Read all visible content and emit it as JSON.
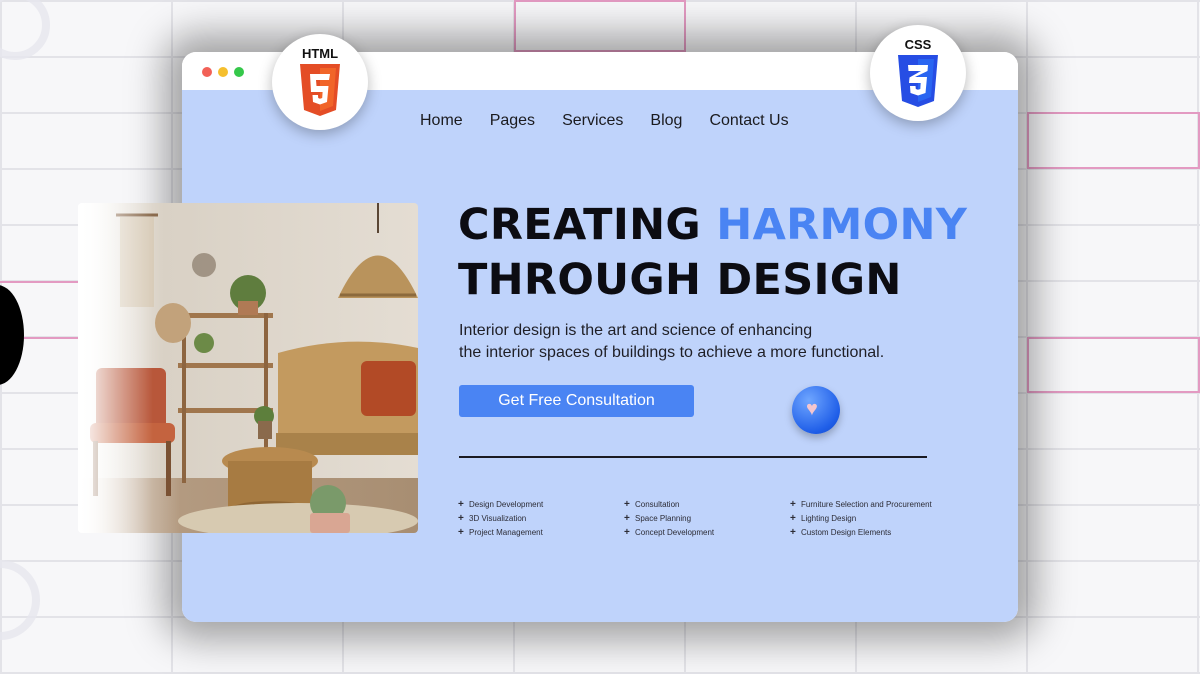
{
  "badges": {
    "html_label": "HTML",
    "css_label": "CSS"
  },
  "nav": {
    "items": [
      "Home",
      "Pages",
      "Services",
      "Blog",
      "Contact Us"
    ]
  },
  "hero": {
    "title_part1": "CREATING",
    "title_accent": "HARMONY",
    "title_line2": "THROUGH DESIGN",
    "desc_line1": "Interior design is the art and science of enhancing",
    "desc_line2": "the interior spaces of buildings to achieve a more functional.",
    "cta_label": "Get Free Consultation"
  },
  "services": {
    "col1": [
      "Design Development",
      "3D Visualization",
      "Project Management"
    ],
    "col2": [
      "Consultation",
      "Space Planning",
      "Concept Development"
    ],
    "col3": [
      "Furniture Selection and Procurement",
      "Lighting Design",
      "Custom Design Elements"
    ]
  },
  "icons": {
    "html5": "html5-logo-icon",
    "css3": "css3-logo-icon",
    "heart": "heart-icon",
    "plus": "plus-icon",
    "window_controls": [
      "close-dot",
      "minimize-dot",
      "maximize-dot"
    ]
  },
  "colors": {
    "accent": "#4a84f3",
    "page_bg": "#bfd3fb",
    "html5": "#e44d26",
    "css3": "#264de4",
    "deco_pink": "#e39ac2"
  }
}
